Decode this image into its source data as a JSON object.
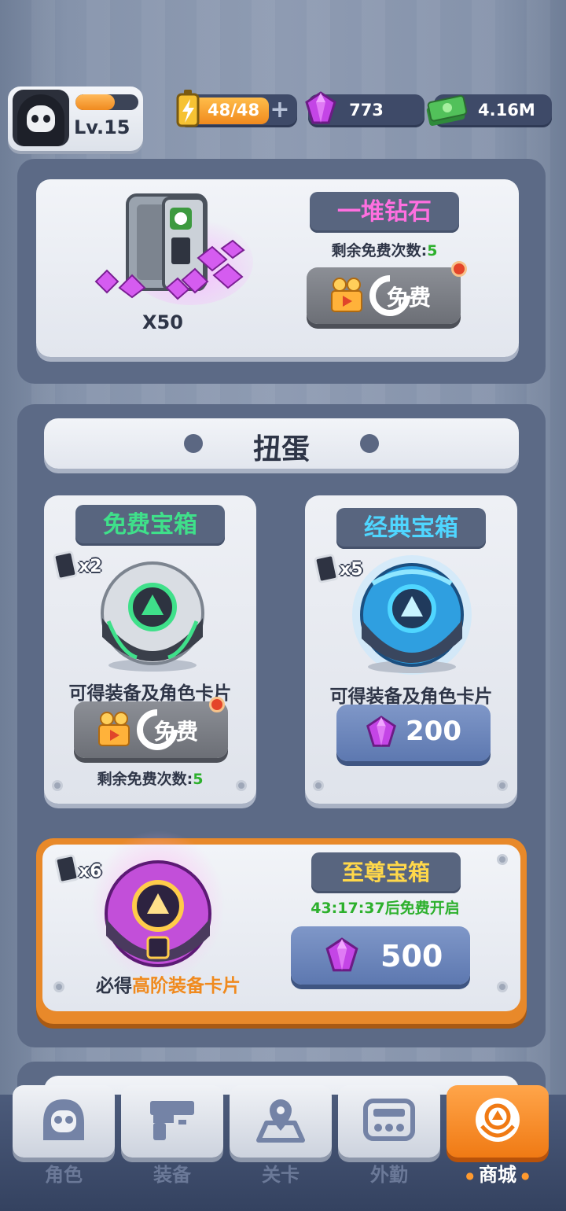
{
  "header": {
    "level": "Lv.15",
    "xp_fraction": 0.62,
    "energy": "48/48",
    "gems": "773",
    "cash": "4.16M"
  },
  "diamond_pile": {
    "title": "一堆钻石",
    "quantity": "X50",
    "remaining_label": "剩余免费次数:",
    "remaining_count": "5",
    "button_label": "免费"
  },
  "gacha": {
    "section_title": "扭蛋",
    "free_chest": {
      "title": "免费宝箱",
      "multiplier": "x2",
      "desc": "可得装备及角色卡片",
      "button_label": "免费",
      "remaining_label": "剩余免费次数:",
      "remaining_count": "5"
    },
    "classic_chest": {
      "title": "经典宝箱",
      "multiplier": "x5",
      "desc": "可得装备及角色卡片",
      "price": "200"
    },
    "supreme_chest": {
      "title": "至尊宝箱",
      "multiplier": "x6",
      "timer": "43:17:37后免费开启",
      "desc_prefix": "必得",
      "desc_highlight": "高阶装备卡片",
      "price": "500"
    }
  },
  "nav": {
    "items": [
      {
        "label": "角色",
        "icon": "skull-icon"
      },
      {
        "label": "装备",
        "icon": "gun-icon"
      },
      {
        "label": "关卡",
        "icon": "map-pin-icon"
      },
      {
        "label": "外勤",
        "icon": "console-icon"
      },
      {
        "label": "商城",
        "icon": "shop-icon"
      }
    ],
    "active_index": 4
  },
  "colors": {
    "accent_orange": "#f07a14",
    "gem_purple": "#c445e6",
    "free_green": "#3fe08a",
    "classic_cyan": "#4fd6ff",
    "supreme_yellow": "#ffd84a",
    "diamond_pink": "#ff6fe0"
  }
}
